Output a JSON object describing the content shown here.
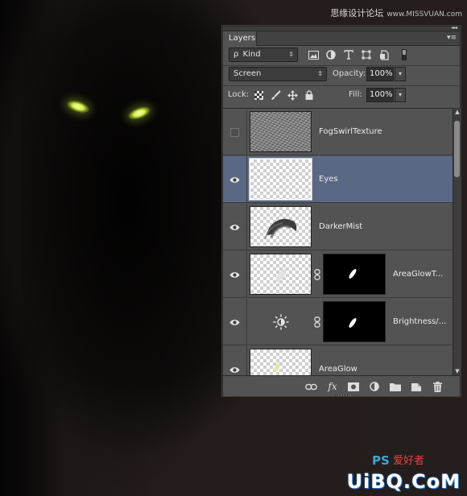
{
  "watermark": {
    "top_cn": "思缘设计论坛",
    "top_url": "www.MISSVUAN.com",
    "bottom_ps": "PS",
    "bottom_cn": "爱好者",
    "bottom_uibo": "UiBQ.CoM"
  },
  "panel": {
    "tab_label": "Layers",
    "kind_label": "Kind",
    "blend_mode": "Screen",
    "opacity_label": "Opacity:",
    "opacity_value": "100%",
    "lock_label": "Lock:",
    "fill_label": "Fill:",
    "fill_value": "100%",
    "filter_icons": [
      "image-filter-icon",
      "adjustment-filter-icon",
      "type-filter-icon",
      "shape-filter-icon",
      "smart-object-filter-icon"
    ],
    "lock_icons": [
      "lock-transparent-icon",
      "lock-image-icon",
      "lock-position-icon",
      "lock-all-icon"
    ],
    "layers": [
      {
        "name": "FogSwirlTexture",
        "visible": false,
        "selected": false,
        "kind": "texture"
      },
      {
        "name": "Eyes",
        "visible": true,
        "selected": true,
        "kind": "transparent"
      },
      {
        "name": "DarkerMist",
        "visible": true,
        "selected": false,
        "kind": "mist"
      },
      {
        "name": "AreaGlowT...",
        "visible": true,
        "selected": false,
        "kind": "masked"
      },
      {
        "name": "Brightness/...",
        "visible": true,
        "selected": false,
        "kind": "adjustment"
      },
      {
        "name": "AreaGlow",
        "visible": true,
        "selected": false,
        "kind": "glow"
      }
    ],
    "bottom_icons": [
      "link-layers-icon",
      "fx-icon",
      "add-mask-icon",
      "new-adjustment-icon",
      "new-group-icon",
      "new-layer-icon",
      "delete-icon"
    ],
    "fx_label": "fx"
  },
  "colors": {
    "panel_bg": "#535353",
    "selected_row": "#5a6884",
    "eye_glow": "#d9f050"
  }
}
